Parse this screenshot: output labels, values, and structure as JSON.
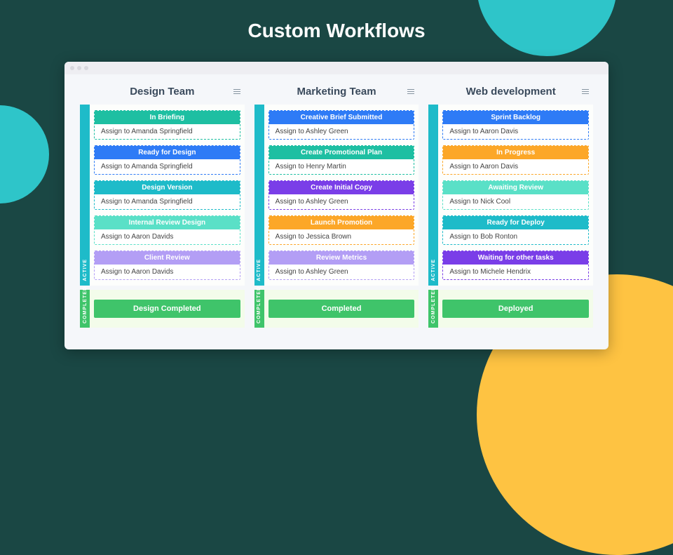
{
  "pageTitle": "Custom Workflows",
  "sectionLabels": {
    "active": "ACTIVE",
    "completed": "COMPLETED"
  },
  "columns": [
    {
      "title": "Design Team",
      "active": [
        {
          "title": "In Briefing",
          "body": "Assign to Amanda Springfield",
          "color": "teal"
        },
        {
          "title": "Ready for Design",
          "body": "Assign to Amanda Springfield",
          "color": "blue"
        },
        {
          "title": "Design Version",
          "body": "Assign to Amanda Springfield",
          "color": "cyan"
        },
        {
          "title": "Internal Review Design",
          "body": "Assign to Aaron Davids",
          "color": "mint"
        },
        {
          "title": "Client Review",
          "body": "Assign to Aaron Davids",
          "color": "lilac"
        }
      ],
      "completed": "Design Completed"
    },
    {
      "title": "Marketing Team",
      "active": [
        {
          "title": "Creative Brief Submitted",
          "body": "Assign to Ashley Green",
          "color": "blue"
        },
        {
          "title": "Create Promotional Plan",
          "body": "Assign to Henry Martin",
          "color": "teal"
        },
        {
          "title": "Create Initial Copy",
          "body": "Assign to Ashley Green",
          "color": "purple"
        },
        {
          "title": "Launch Promotion",
          "body": "Assign to Jessica Brown",
          "color": "orange"
        },
        {
          "title": "Review Metrics",
          "body": "Assign to Ashley Green",
          "color": "lilac"
        }
      ],
      "completed": "Completed"
    },
    {
      "title": "Web development",
      "active": [
        {
          "title": "Sprint Backlog",
          "body": "Assign to Aaron Davis",
          "color": "blue"
        },
        {
          "title": "In Progress",
          "body": "Assign to Aaron Davis",
          "color": "orange"
        },
        {
          "title": "Awaiting Review",
          "body": "Assign to Nick Cool",
          "color": "mint"
        },
        {
          "title": "Ready for Deploy",
          "body": "Assign to Bob Ronton",
          "color": "cyan"
        },
        {
          "title": "Waiting for other tasks",
          "body": "Assign to Michele Hendrix",
          "color": "purple"
        }
      ],
      "completed": "Deployed"
    }
  ]
}
